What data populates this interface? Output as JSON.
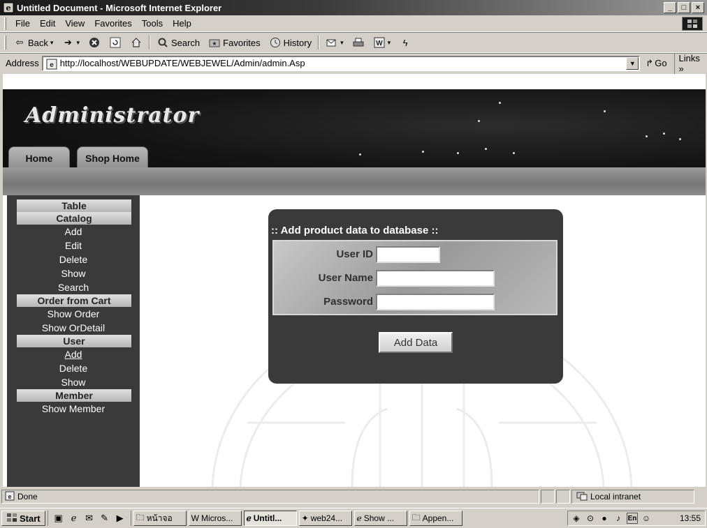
{
  "window": {
    "title": "Untitled Document - Microsoft Internet Explorer",
    "controls": {
      "minimize": "_",
      "maximize": "□",
      "close": "×"
    }
  },
  "menu": {
    "items": [
      {
        "label": "File"
      },
      {
        "label": "Edit"
      },
      {
        "label": "View"
      },
      {
        "label": "Favorites"
      },
      {
        "label": "Tools"
      },
      {
        "label": "Help"
      }
    ]
  },
  "toolbar": {
    "back_label": "Back",
    "search_label": "Search",
    "favorites_label": "Favorites",
    "history_label": "History"
  },
  "address": {
    "label": "Address",
    "url": "http://localhost/WEBUPDATE/WEBJEWEL/Admin/admin.Asp",
    "go_label": "Go",
    "links_label": "Links"
  },
  "page": {
    "banner_title": "Administrator",
    "tabs": [
      {
        "label": "Home"
      },
      {
        "label": "Shop Home"
      }
    ],
    "nav": {
      "table_header": "Table",
      "catalog_header": "Catalog",
      "catalog_links": [
        "Add",
        "Edit",
        "Delete",
        "Show",
        "Search"
      ],
      "order_header": "Order from Cart",
      "order_links": [
        "Show Order",
        "Show OrDetail"
      ],
      "user_header": "User",
      "user_links": [
        "Add",
        "Delete",
        "Show"
      ],
      "member_header": "Member",
      "member_links": [
        "Show Member"
      ]
    },
    "form": {
      "title": ":: Add product data to database ::",
      "fields": [
        {
          "label": "User ID",
          "value": ""
        },
        {
          "label": "User Name",
          "value": ""
        },
        {
          "label": "Password",
          "value": ""
        }
      ],
      "submit_label": "Add Data"
    }
  },
  "status": {
    "text": "Done",
    "zone": "Local intranet"
  },
  "taskbar": {
    "start_label": "Start",
    "tasks": [
      {
        "label": "หน้าจอ",
        "active": false
      },
      {
        "label": "Micros...",
        "active": false
      },
      {
        "label": "Untitl...",
        "active": true
      },
      {
        "label": "web24...",
        "active": false
      },
      {
        "label": "Show ...",
        "active": false
      },
      {
        "label": "Appen...",
        "active": false
      }
    ],
    "tray_lang": "En",
    "clock": "13:55"
  }
}
